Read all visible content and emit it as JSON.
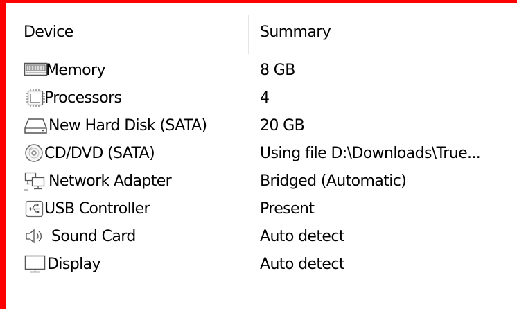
{
  "columns": {
    "device": "Device",
    "summary": "Summary"
  },
  "devices": [
    {
      "icon": "memory-icon",
      "name": "Memory",
      "summary": "8 GB"
    },
    {
      "icon": "processor-icon",
      "name": "Processors",
      "summary": "4"
    },
    {
      "icon": "hard-disk-icon",
      "name": "New Hard Disk (SATA)",
      "summary": "20 GB"
    },
    {
      "icon": "cd-dvd-icon",
      "name": "CD/DVD (SATA)",
      "summary": "Using file D:\\Downloads\\True..."
    },
    {
      "icon": "network-adapter-icon",
      "name": "Network Adapter",
      "summary": "Bridged (Automatic)"
    },
    {
      "icon": "usb-icon",
      "name": "USB Controller",
      "summary": "Present"
    },
    {
      "icon": "sound-card-icon",
      "name": "Sound Card",
      "summary": "Auto detect"
    },
    {
      "icon": "display-icon",
      "name": "Display",
      "summary": "Auto detect"
    }
  ],
  "colors": {
    "frame_border": "#ff0000",
    "background": "#ffffff",
    "icon_stroke": "#555555"
  }
}
